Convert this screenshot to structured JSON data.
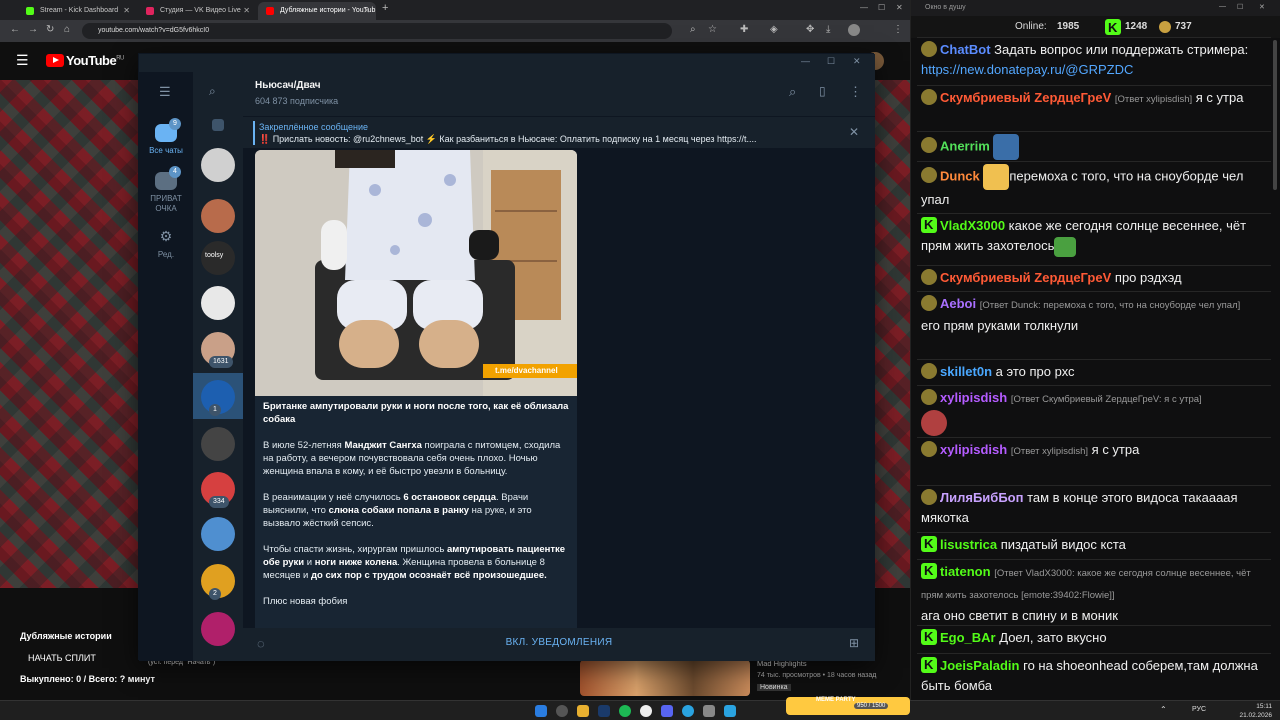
{
  "browser": {
    "tabs": [
      {
        "label": "Stream - Kick Dashboard",
        "favicon_color": "#53fc18"
      },
      {
        "label": "Студия — VK Видео Live",
        "favicon_color": "#e0245e"
      },
      {
        "label": "Дубляжные истории - YouTub",
        "favicon_color": "#ff0000"
      }
    ],
    "new_tab": "+",
    "url": "youtube.com/watch?v=dG5fv6hkcI0"
  },
  "youtube": {
    "logo_text": "YouTube",
    "region": "RU",
    "video_title": "Дубляжные истории",
    "split_button": "НАЧАТЬ СПЛИТ",
    "split_hint": "(уст. перед \"Начать\")",
    "bought": "Выкуплено: 0 / Всего: ? минут",
    "recommended": {
      "channel": "Mad Highlights",
      "meta": "74 тыс. просмотров • 18 часов назад",
      "badge": "Новинка"
    }
  },
  "telegram": {
    "sidebar": [
      {
        "label": "Все чаты",
        "badge": "9",
        "active": true
      },
      {
        "label": "ПРИВАТ ОЧКА",
        "badge": "4",
        "active": false
      },
      {
        "label": "Ред.",
        "badge": "",
        "active": false
      }
    ],
    "avatars": [
      {
        "color": "#d0d0d0",
        "badge": ""
      },
      {
        "color": "#b86b4b",
        "badge": ""
      },
      {
        "color": "#2a2a2a",
        "badge": "",
        "text": "toolsy"
      },
      {
        "color": "#e8e8e8",
        "badge": ""
      },
      {
        "color": "#c9a088",
        "badge": "1631"
      },
      {
        "color": "#1d5fb0",
        "badge": "1",
        "selected": true
      },
      {
        "color": "#444444",
        "badge": ""
      },
      {
        "color": "#d64040",
        "badge": "334"
      },
      {
        "color": "#4f8fd0",
        "badge": ""
      },
      {
        "color": "#e0a020",
        "badge": "2"
      },
      {
        "color": "#b0206a",
        "badge": ""
      }
    ],
    "channel": {
      "name": "Ньюсач/Двач",
      "subscribers": "604 873 подписчика"
    },
    "pinned": {
      "title": "Закреплённое сообщение",
      "text": "‼️ Прислать новость: @ru2chnews_bot  ⚡ Как разбаниться в Ньюсаче:   Оплатить подписку на 1 месяц через https://t...."
    },
    "post": {
      "watermark": "t.me/dvachannel",
      "headline": "Британке ампутировали руки и ноги после того, как её облизала собака",
      "p1_a": "В июле 52-летняя ",
      "p1_b": "Манджит Сангха",
      "p1_c": " поиграла с питомцем, сходила на работу, а вечером почувствовала себя очень плохо. Ночью женщина впала в кому, и её быстро увезли в больницу.",
      "p2_a": "В реанимации у неё случилось ",
      "p2_b": "6 остановок сердца",
      "p2_c": ". Врачи выяснили, что ",
      "p2_d": "слюна собаки попала в ранку",
      "p2_e": " на руке, и это вызвало жёсткий сепсис.",
      "p3_a": "Чтобы спасти жизнь, хирургам пришлось ",
      "p3_b": "ампутировать пациентке обе руки",
      "p3_c": " и ",
      "p3_d": "ноги ниже колена",
      "p3_e": ". Женщина провела в больнице 8 месяцев и ",
      "p3_f": "до сих пор с трудом осознаёт всё произошедшее.",
      "p4": "Плюс новая фобия"
    },
    "footer_button": "ВКЛ. УВЕДОМЛЕНИЯ"
  },
  "chat": {
    "window_title": "Окно в душу",
    "online_label": "Online:",
    "online": "1985",
    "kick_count": "1248",
    "other_count": "737",
    "messages": [
      {
        "user": "ChatBot",
        "color": "#5b8cff",
        "reply": "",
        "text": "Задать вопрос или поддержать стримера: ",
        "link": "https://new.donatepay.ru/@GRPZDC"
      },
      {
        "user": "Скумбриевый ZердцеГреV",
        "color": "#ff5a36",
        "reply": "[Ответ xylipisdish]",
        "text": "я с утра",
        "link": ""
      },
      {
        "user": "Anerrim",
        "color": "#53e05a",
        "reply": "",
        "text": "",
        "link": ""
      },
      {
        "user": "Dunck",
        "color": "#ff8a3c",
        "reply": "",
        "text": "перемоха с того, что на сноуборде чел упал",
        "link": ""
      },
      {
        "user": "VladX3000",
        "color": "#53fc18",
        "reply": "",
        "text": "какое же сегодня солнце весеннее, чёт прям жить захотелось",
        "link": ""
      },
      {
        "user": "Скумбриевый ZердцеГреV",
        "color": "#ff5a36",
        "reply": "",
        "text": "про рэдхэд",
        "link": ""
      },
      {
        "user": "Aeboi",
        "color": "#a970ff",
        "reply": "[Ответ Dunck: перемоха с того, что на сноуборде чел упал]",
        "text": "его прям руками толкнули",
        "link": ""
      },
      {
        "user": "skillet0n",
        "color": "#4aa8ff",
        "reply": "",
        "text": "а это про рхс",
        "link": ""
      },
      {
        "user": "xylipisdish",
        "color": "#b45cff",
        "reply": "[Ответ Скумбриевый ZердцеГреV: я с утра]",
        "text": "",
        "link": ""
      },
      {
        "user": "xylipisdish",
        "color": "#b45cff",
        "reply": "[Ответ xylipisdish]",
        "text": "я с утра",
        "link": ""
      },
      {
        "user": "ЛиляБибБоп",
        "color": "#c8a2ff",
        "reply": "",
        "text": "там в конце этого видоса такаааая мякотка",
        "link": ""
      },
      {
        "user": "lisustrica",
        "color": "#53fc18",
        "reply": "",
        "text": "пиздатый видос кста",
        "link": ""
      },
      {
        "user": "tiatenon",
        "color": "#53fc18",
        "reply": "[Ответ VladX3000: какое же сегодня солнце весеннее, чёт прям жить захотелось [emote:39402:Flowie]]",
        "text": "ага оно светит в спину и в моник",
        "link": ""
      },
      {
        "user": "Ego_BAr",
        "color": "#53fc18",
        "reply": "",
        "text": "Доел, зато вкусно",
        "link": ""
      },
      {
        "user": "JoeisPaladin",
        "color": "#53fc18",
        "reply": "",
        "text": "го на shoeonhead соберем,там должна быть бомба",
        "link": ""
      }
    ]
  },
  "taskbar": {
    "lang": "РУС",
    "time": "15:11",
    "date": "21.02.2026",
    "meme_party": "MEME PARTY",
    "meme_count": "950 / 1500"
  }
}
